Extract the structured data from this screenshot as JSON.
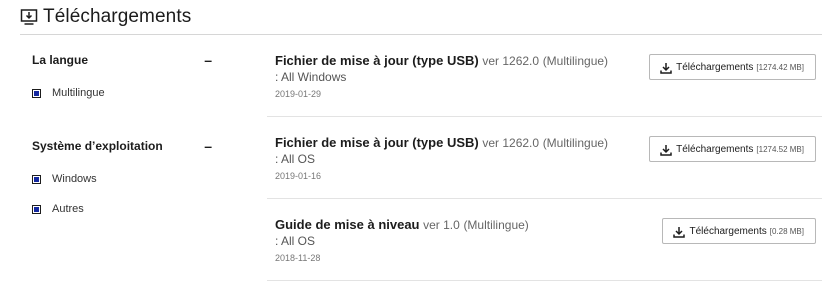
{
  "header": {
    "title": "Téléchargements",
    "icon": "download-monitor-icon"
  },
  "filters": [
    {
      "title": "La langue",
      "collapse_symbol": "–",
      "options": [
        {
          "label": "Multilingue",
          "checked": true
        }
      ]
    },
    {
      "title": "Système d’exploitation",
      "collapse_symbol": "–",
      "options": [
        {
          "label": "Windows",
          "checked": true
        },
        {
          "label": "Autres",
          "checked": true
        }
      ]
    }
  ],
  "downloads": [
    {
      "name": "Fichier de mise à jour (type USB)",
      "version": "ver 1262.0",
      "language": "(Multilingue)",
      "os": ": All Windows",
      "date": "2019-01-29",
      "button_label": "Téléchargements",
      "size": "[1274.42 MB]"
    },
    {
      "name": "Fichier de mise à jour (type USB)",
      "version": "ver 1262.0",
      "language": "(Multilingue)",
      "os": ": All OS",
      "date": "2019-01-16",
      "button_label": "Téléchargements",
      "size": "[1274.52 MB]"
    },
    {
      "name": "Guide de mise à niveau",
      "version": "ver 1.0",
      "language": "(Multilingue)",
      "os": ": All OS",
      "date": "2018-11-28",
      "button_label": "Téléchargements",
      "size": "[0.28 MB]"
    }
  ],
  "colors": {
    "accent": "#1428a0",
    "divider": "#e3e3e3",
    "text": "#1c1c1c"
  }
}
